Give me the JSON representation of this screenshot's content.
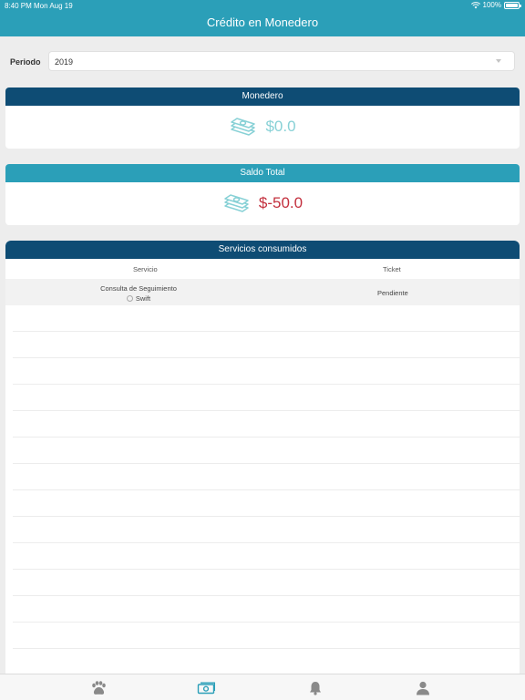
{
  "status": {
    "time": "8:40 PM",
    "date": "Mon Aug 19",
    "battery": "100%"
  },
  "nav": {
    "title": "Crédito en Monedero"
  },
  "period": {
    "label": "Periodo",
    "value": "2019"
  },
  "wallet": {
    "title": "Monedero",
    "amount": "$0.0",
    "icon": "money-icon"
  },
  "total": {
    "title": "Saldo Total",
    "amount": "$-50.0",
    "icon": "money-icon"
  },
  "services": {
    "title": "Servicios consumidos",
    "columns": [
      "Servicio",
      "Ticket"
    ],
    "rows": [
      {
        "service": "Consulta de Seguimiento",
        "pet": "Swift",
        "ticket": "Pendiente"
      }
    ]
  },
  "tabs": [
    {
      "name": "paw-icon",
      "active": false
    },
    {
      "name": "money-icon",
      "active": true
    },
    {
      "name": "bell-icon",
      "active": false
    },
    {
      "name": "user-icon",
      "active": false
    }
  ],
  "colors": {
    "teal": "#2b9fb8",
    "navy": "#0e4c74",
    "light_teal": "#88d1d6",
    "negative": "#c3303e",
    "tab_inactive": "#8a8a8a"
  }
}
